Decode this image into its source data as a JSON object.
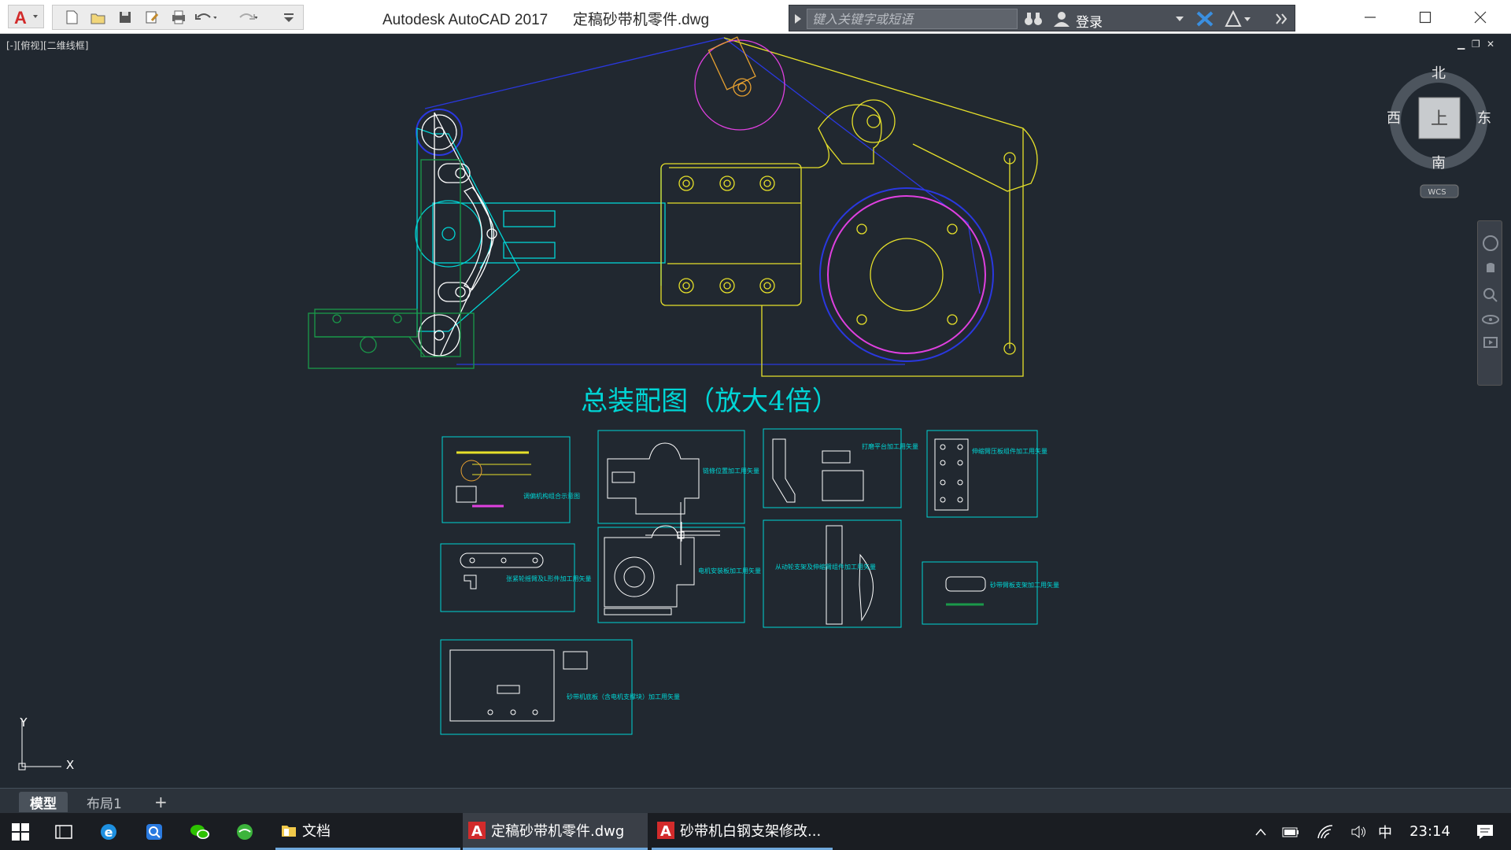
{
  "window": {
    "app_name": "Autodesk AutoCAD 2017",
    "file_name": "定稿砂带机零件.dwg"
  },
  "search": {
    "placeholder": "键入关键字或短语"
  },
  "account": {
    "login_label": "登录"
  },
  "viewport": {
    "view_label": "[-][俯视][二维线框]",
    "drawing_title": "总装配图（放大4倍）",
    "viewcube": {
      "north": "北",
      "south": "南",
      "east": "东",
      "west": "西",
      "top": "上",
      "wcs": "WCS"
    },
    "ucs": {
      "x": "X",
      "y": "Y"
    },
    "details": [
      "调偏机构组合示意图",
      "链條位置加工用矢量",
      "打磨平台加工用矢量",
      "伸缩臂压板组件加工用矢量",
      "张紧轮摇臂及L形件加工用矢量",
      "电机安装板加工用矢量",
      "从动轮支架及伸缩臂组件加工用矢量",
      "砂带臂板支架加工用矢量",
      "砂带机底板（含电机支撑块）加工用矢量"
    ]
  },
  "tabs": {
    "model": "模型",
    "layout1": "布局1",
    "add": "+"
  },
  "taskbar": {
    "docs_label": "文档",
    "task1": "定稿砂带机零件.dwg",
    "task2": "砂带机白钢支架修改...",
    "ime": "中",
    "time": "23:14"
  },
  "colors": {
    "canvas": "#212830",
    "cyan": "#00d5d5",
    "yellow": "#e6e02a",
    "magenta": "#e040e0",
    "blue": "#2a38e0",
    "green": "#1a9a4a",
    "white": "#ffffff",
    "autocad_red": "#d22b2b"
  }
}
